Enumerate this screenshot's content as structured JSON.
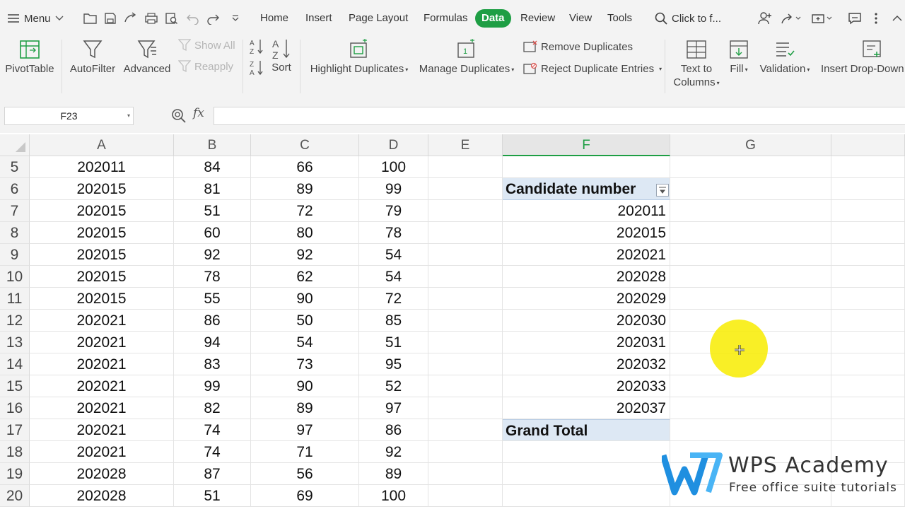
{
  "menu": {
    "label": "Menu"
  },
  "tabs": [
    {
      "label": "Home"
    },
    {
      "label": "Insert"
    },
    {
      "label": "Page Layout"
    },
    {
      "label": "Formulas"
    },
    {
      "label": "Data"
    },
    {
      "label": "Review"
    },
    {
      "label": "View"
    },
    {
      "label": "Tools"
    }
  ],
  "active_tab": "Data",
  "search": {
    "placeholder": "Click to f..."
  },
  "ribbon": {
    "pivottable": "PivotTable",
    "autofilter": "AutoFilter",
    "advanced": "Advanced",
    "show_all": "Show All",
    "reapply": "Reapply",
    "sort": "Sort",
    "highlight_duplicates": "Highlight Duplicates",
    "manage_duplicates": "Manage Duplicates",
    "remove_duplicates": "Remove Duplicates",
    "reject_duplicate_entries": "Reject Duplicate Entries",
    "text_to_columns_1": "Text to",
    "text_to_columns_2": "Columns",
    "fill": "Fill",
    "validation": "Validation",
    "insert_dropdown": "Insert Drop-Down"
  },
  "formula_bar": {
    "name_box": "F23",
    "fx": "fx",
    "formula": ""
  },
  "columns": [
    "A",
    "B",
    "C",
    "D",
    "E",
    "F",
    "G"
  ],
  "selected_column": "F",
  "rows": [
    {
      "num": "5",
      "a": "202011",
      "b": "84",
      "c": "66",
      "d": "100",
      "f": ""
    },
    {
      "num": "6",
      "a": "202015",
      "b": "81",
      "c": "89",
      "d": "99",
      "f": "Candidate number"
    },
    {
      "num": "7",
      "a": "202015",
      "b": "51",
      "c": "72",
      "d": "79",
      "f": "202011"
    },
    {
      "num": "8",
      "a": "202015",
      "b": "60",
      "c": "80",
      "d": "78",
      "f": "202015"
    },
    {
      "num": "9",
      "a": "202015",
      "b": "92",
      "c": "92",
      "d": "54",
      "f": "202021"
    },
    {
      "num": "10",
      "a": "202015",
      "b": "78",
      "c": "62",
      "d": "54",
      "f": "202028"
    },
    {
      "num": "11",
      "a": "202015",
      "b": "55",
      "c": "90",
      "d": "72",
      "f": "202029"
    },
    {
      "num": "12",
      "a": "202021",
      "b": "86",
      "c": "50",
      "d": "85",
      "f": "202030"
    },
    {
      "num": "13",
      "a": "202021",
      "b": "94",
      "c": "54",
      "d": "51",
      "f": "202031"
    },
    {
      "num": "14",
      "a": "202021",
      "b": "83",
      "c": "73",
      "d": "95",
      "f": "202032"
    },
    {
      "num": "15",
      "a": "202021",
      "b": "99",
      "c": "90",
      "d": "52",
      "f": "202033"
    },
    {
      "num": "16",
      "a": "202021",
      "b": "82",
      "c": "89",
      "d": "97",
      "f": "202037"
    },
    {
      "num": "17",
      "a": "202021",
      "b": "74",
      "c": "97",
      "d": "86",
      "f": "Grand Total"
    },
    {
      "num": "18",
      "a": "202021",
      "b": "74",
      "c": "71",
      "d": "92",
      "f": ""
    },
    {
      "num": "19",
      "a": "202028",
      "b": "87",
      "c": "56",
      "d": "89",
      "f": ""
    },
    {
      "num": "20",
      "a": "202028",
      "b": "51",
      "c": "69",
      "d": "100",
      "f": ""
    }
  ],
  "watermark": {
    "title": "WPS Academy",
    "subtitle": "Free office suite tutorials"
  },
  "colors": {
    "accent": "#1e9e44",
    "pivot_header": "#dde8f4",
    "highlight": "#f8ec00"
  }
}
